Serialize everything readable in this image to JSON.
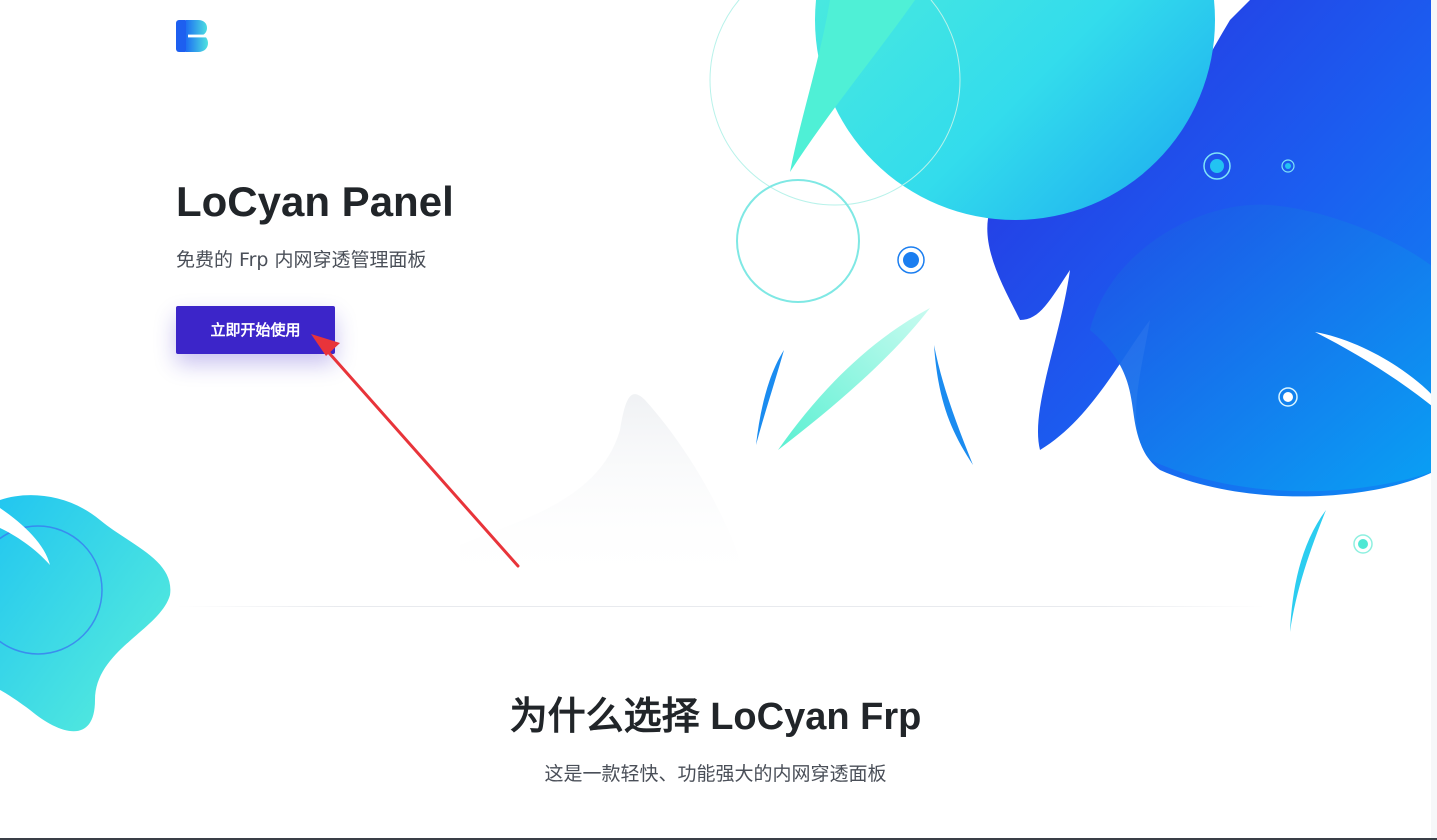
{
  "brand": {
    "logo_icon": "brand-b-logo-icon",
    "gradient_colors": [
      "#1d6ff2",
      "#4fe3e0"
    ]
  },
  "hero": {
    "title": "LoCyan Panel",
    "subtitle": "免费的 Frp 内网穿透管理面板",
    "start_button_label": "立即开始使用"
  },
  "features": {
    "title": "为什么选择 LoCyan Frp",
    "subtitle": "这是一款轻快、功能强大的内网穿透面板"
  },
  "annotation": {
    "icon": "red-arrow-pointer-icon",
    "color": "#e8343a"
  },
  "colors": {
    "accent": "#3c25c9",
    "heading": "#212529",
    "text": "#4a4f58",
    "blob_blue": "#1b52e6",
    "blob_cyan": "#44e6dc"
  }
}
